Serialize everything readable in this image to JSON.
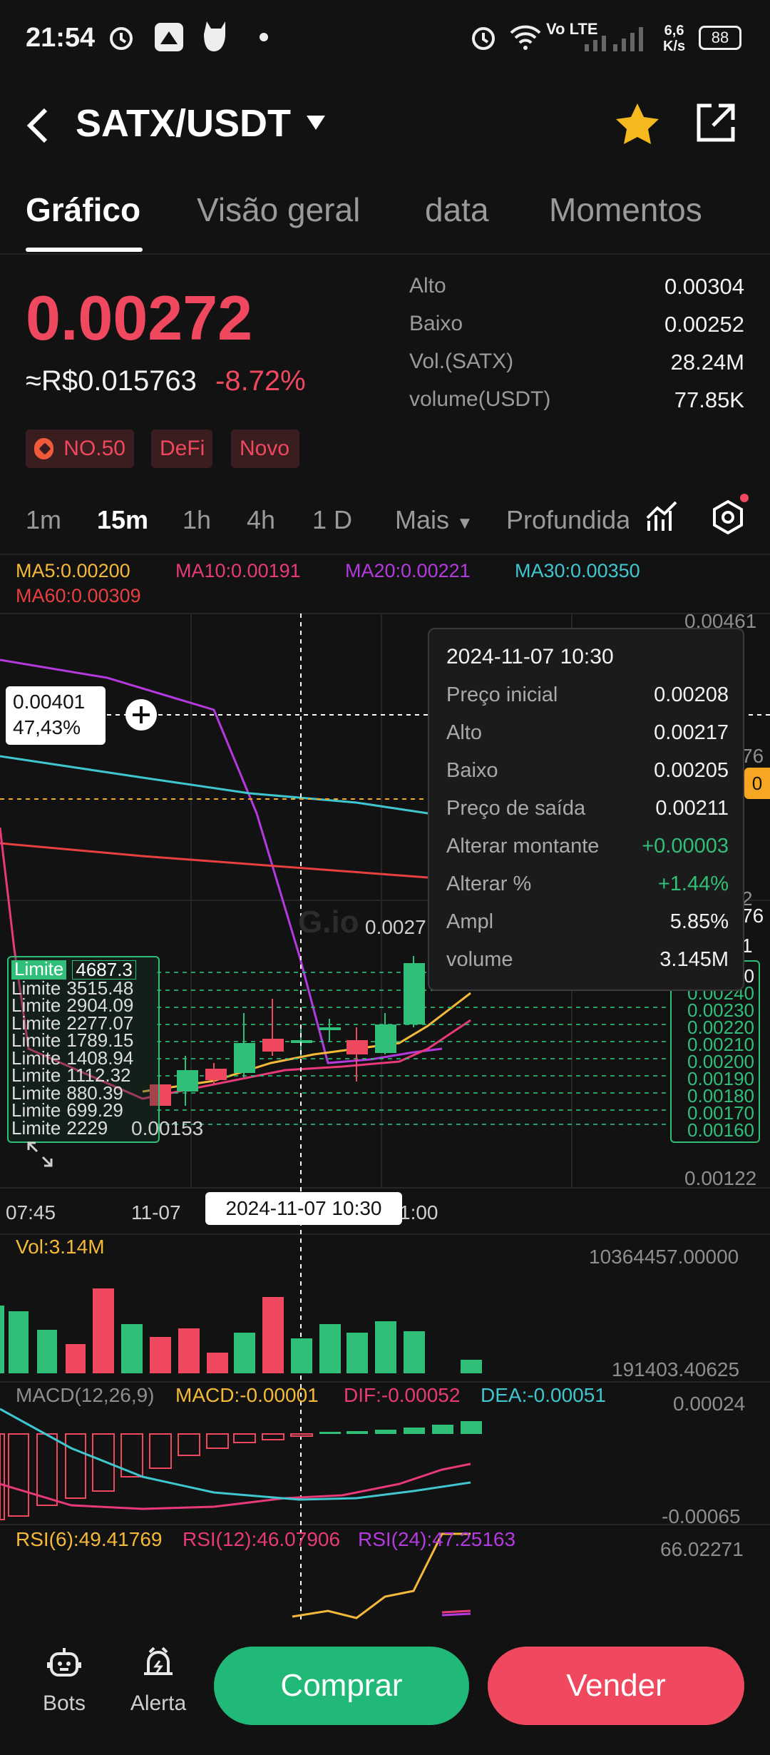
{
  "status": {
    "time": "21:54",
    "net_speed_top": "6,6",
    "net_speed_bottom": "K/s",
    "battery": "88",
    "network": "Vo LTE"
  },
  "header": {
    "pair": "SATX/USDT"
  },
  "tabs": [
    "Gráfico",
    "Visão geral",
    "data",
    "Momentos"
  ],
  "ticker": {
    "price": "0.00272",
    "fiat": "≈R$0.015763",
    "change": "-8.72%",
    "stats": [
      {
        "label": "Alto",
        "value": "0.00304"
      },
      {
        "label": "Baixo",
        "value": "0.00252"
      },
      {
        "label": "Vol.(SATX)",
        "value": "28.24M"
      },
      {
        "label": "volume(USDT)",
        "value": "77.85K"
      }
    ],
    "tags": [
      "NO.50",
      "DeFi",
      "Novo"
    ]
  },
  "intervals": [
    "1m",
    "15m",
    "1h",
    "4h",
    "1 D",
    "Mais",
    "Profundida"
  ],
  "ma_legend": {
    "ma5": "MA5:0.00200",
    "ma10": "MA10:0.00191",
    "ma20": "MA20:0.00221",
    "ma30": "MA30:0.00350",
    "ma60": "MA60:0.00309"
  },
  "colors": {
    "up": "#2fbf78",
    "down": "#f0485e",
    "ma5": "#f5b93a",
    "ma10": "#e8397a",
    "ma20": "#b43adf",
    "ma30": "#3fc6cf",
    "ma60": "#e84040"
  },
  "price_axis": {
    "top": "0.00461",
    "bottom": "0.00122",
    "partial_labels": [
      "76",
      "0",
      "2",
      "1"
    ],
    "levels": [
      "0.00240",
      "0.00230",
      "0.00220",
      "0.00210",
      "0.00200",
      "0.00190",
      "0.00180",
      "0.00170",
      "0.00160"
    ],
    "level_top": "0"
  },
  "crosshair": {
    "price": "0.00401",
    "pct": "47,43%",
    "time": "2024-11-07 10:30"
  },
  "last_price_marker": "0.0027",
  "low_marker": "0.00153",
  "limits": {
    "label": "Limite",
    "values": [
      "4687.3",
      "3515.48",
      "2904.09",
      "2277.07",
      "1789.15",
      "1408.94",
      "1112.32",
      "880.39",
      "699.29",
      "2229"
    ]
  },
  "time_axis": [
    "07:45",
    "11-07",
    "1:00"
  ],
  "tooltip": {
    "date": "2024-11-07 10:30",
    "rows": [
      {
        "label": "Preço inicial",
        "value": "0.00208"
      },
      {
        "label": "Alto",
        "value": "0.00217"
      },
      {
        "label": "Baixo",
        "value": "0.00205"
      },
      {
        "label": "Preço de saída",
        "value": "0.00211"
      },
      {
        "label": "Alterar montante",
        "value": "+0.00003"
      },
      {
        "label": "Alterar %",
        "value": "+1.44%"
      },
      {
        "label": "Ampl",
        "value": "5.85%"
      },
      {
        "label": "volume",
        "value": "3.145M"
      }
    ]
  },
  "volume": {
    "label": "Vol:3.14M",
    "max": "10364457.00000",
    "min": "191403.40625"
  },
  "macd": {
    "label": "MACD(12,26,9)",
    "macd": "MACD:-0.00001",
    "dif": "DIF:-0.00052",
    "dea": "DEA:-0.00051",
    "max": "0.00024",
    "min": "-0.00065"
  },
  "rsi": {
    "rsi6": "RSI(6):49.41769",
    "rsi12": "RSI(12):46.07906",
    "rsi24": "RSI(24):47.25163",
    "max": "66.02271"
  },
  "bottom": {
    "bots": "Bots",
    "alert": "Alerta",
    "buy": "Comprar",
    "sell": "Vender"
  }
}
